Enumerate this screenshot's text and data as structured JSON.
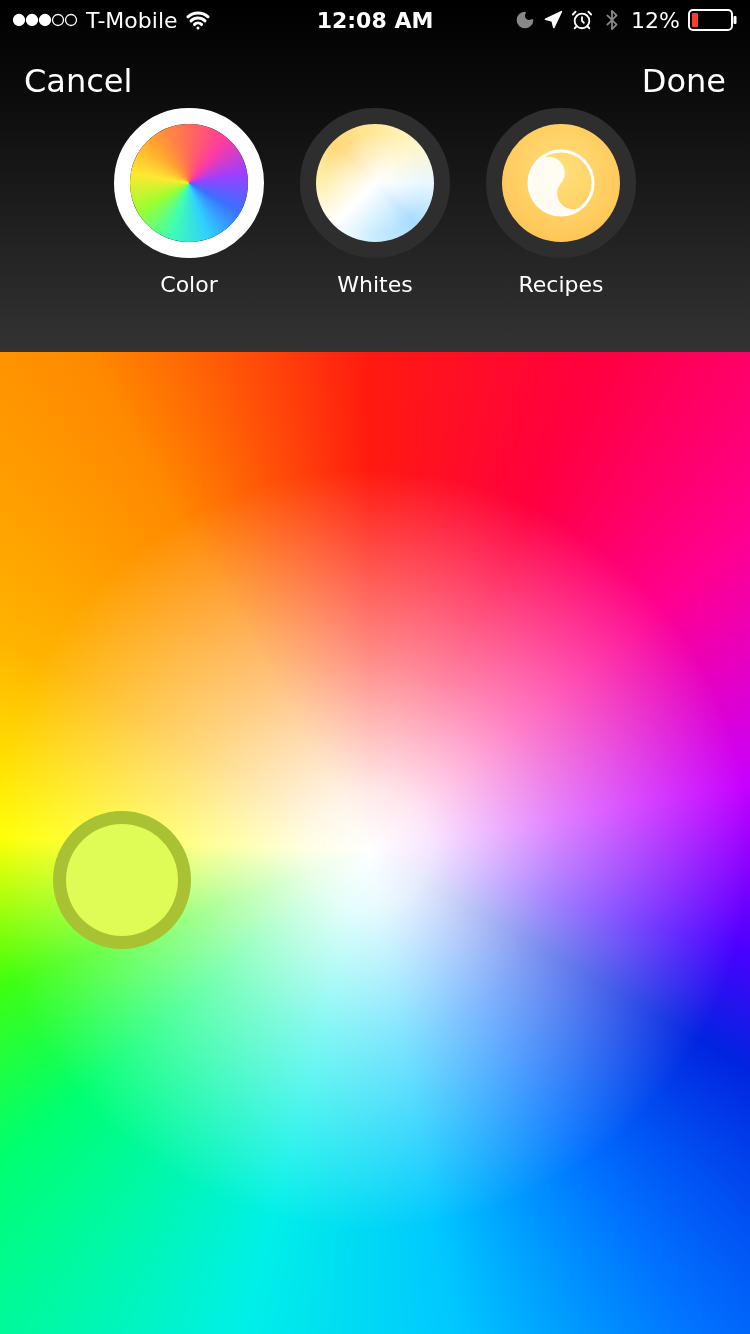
{
  "status_bar": {
    "carrier": "T-Mobile",
    "time": "12:08 AM",
    "battery": "12%"
  },
  "nav": {
    "cancel": "Cancel",
    "done": "Done"
  },
  "modes": [
    {
      "label": "Color",
      "kind": "color",
      "selected": true
    },
    {
      "label": "Whites",
      "kind": "whites",
      "selected": false
    },
    {
      "label": "Recipes",
      "kind": "recipes",
      "selected": false
    }
  ]
}
